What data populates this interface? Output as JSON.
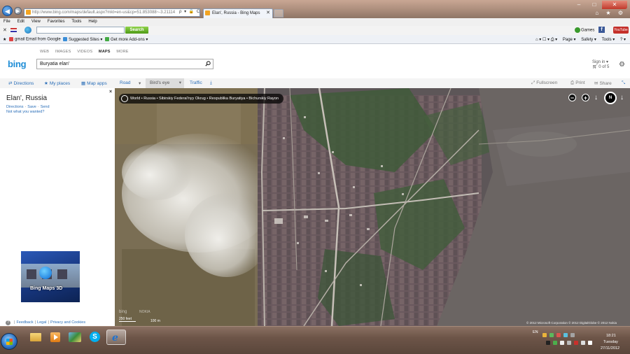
{
  "browser": {
    "address": "http://www.bing.com/maps/default.aspx?mkt=en-us&cp=51.853088~-3.21114",
    "address_controls": "ρ ▾ 🔒 C ✕",
    "tab_title": "Elan', Russia - Bing Maps",
    "tab_close": "✕",
    "window_buttons": {
      "minimize": "–",
      "maximize": "□",
      "close": "✕"
    },
    "ie_icons": "⌂ ★ ⚙"
  },
  "menu": [
    "File",
    "Edit",
    "View",
    "Favorites",
    "Tools",
    "Help"
  ],
  "toolbar": {
    "search_button": "Search",
    "games_label": "Games",
    "fb_label": "f",
    "yt_label": "YouTube"
  },
  "favorites": {
    "items": [
      "gmail Email from Google",
      "Suggested Sites ▾",
      "Get more Add-ons ▾"
    ],
    "commands": [
      "Page ▾",
      "Safety ▾",
      "Tools ▾",
      "? ▾"
    ]
  },
  "bing": {
    "nav": [
      "WEB",
      "IMAGES",
      "VIDEOS",
      "MAPS",
      "MORE"
    ],
    "logo": "bing",
    "search_value": "Buryatia elan'",
    "sign_in": "Sign in ▾",
    "cart": "0 of 5"
  },
  "map_toolbar": {
    "directions": "Directions",
    "my_places": "My places",
    "map_apps": "Map apps",
    "road": "Road",
    "birds_eye": "Bird's eye",
    "traffic": "Traffic",
    "fullscreen": "Fullscreen",
    "print": "Print",
    "share": "Share"
  },
  "panel": {
    "title": "Elan', Russia",
    "links": [
      "Directions",
      "Save",
      "Send"
    ],
    "not_wanted": "Not what you wanted?",
    "ad_text": "Bing Maps 3D",
    "footer": [
      "Feedback",
      "Legal",
      "Privacy and Cookies"
    ]
  },
  "map": {
    "breadcrumb": "World • Russia • Sibirskiy Federal'nyy Okrug • Respublika Buryatiya • Bichurskiy Rayon",
    "compass": "N",
    "logo": "bing",
    "nokia": "NOKIA",
    "scale_ft": "250 feet",
    "scale_m": "100 m",
    "copyright": "© 2012 Microsoft Corporation   © 2012 DigitalGlobe   © 2012 Nokia"
  },
  "taskbar": {
    "lang": "EN",
    "time": "18:21",
    "day": "Tuesday",
    "date": "27/11/2012"
  }
}
